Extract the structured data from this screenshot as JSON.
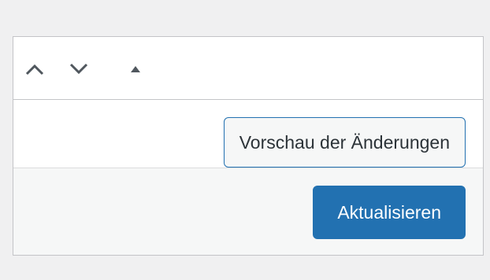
{
  "icons": {
    "move_up": "chevron-up-icon",
    "move_down": "chevron-down-icon",
    "toggle_panel": "triangle-up-icon"
  },
  "publish_box": {
    "preview_label": "Vorschau der Änderungen",
    "update_label": "Aktualisieren"
  },
  "colors": {
    "background": "#f0f0f1",
    "panel": "#ffffff",
    "border": "#c3c4c7",
    "accent": "#2271b1",
    "icon": "#50575e",
    "footer": "#f6f7f7"
  }
}
